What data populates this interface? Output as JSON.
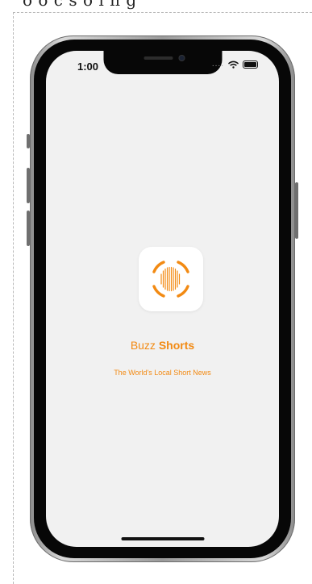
{
  "page": {
    "cut_off_text": "o o  c  s o  i n  g"
  },
  "status_bar": {
    "time": "1:00",
    "signal_dots": "....",
    "wifi_icon": "wifi-icon",
    "battery_icon": "battery-icon"
  },
  "app": {
    "icon_name": "buzz-shorts-logo-icon",
    "title_regular": "Buzz ",
    "title_bold": "Shorts",
    "tagline": "The World's Local Short News"
  },
  "colors": {
    "accent": "#F28A13",
    "screen_background": "#F1F1F1",
    "phone_bezel": "#070707"
  }
}
